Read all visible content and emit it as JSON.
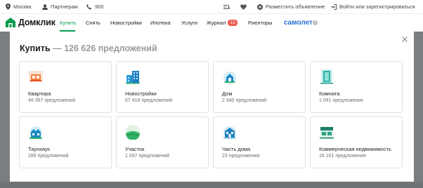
{
  "topbar": {
    "city": "Москва",
    "partners": "Партнерам",
    "phone": "900",
    "post_ad": "Разместить объявление",
    "login": "Войти или зарегистрироваться"
  },
  "nav": {
    "logo": "Домклик",
    "items": [
      {
        "label": "Купить",
        "active": true
      },
      {
        "label": "Снять"
      },
      {
        "label": "Новостройки"
      },
      {
        "label": "Ипотека"
      },
      {
        "label": "Услуги"
      },
      {
        "label": "Журнал",
        "badge": "13"
      },
      {
        "label": "Риелторы"
      }
    ],
    "partner_brand": "самолет"
  },
  "modal": {
    "title": "Купить",
    "count_text": "— 126 626 предложений",
    "cards": [
      {
        "name": "Квартира",
        "count": "48 367 предложений",
        "icon": "apartment-icon"
      },
      {
        "name": "Новостройки",
        "count": "57 418 предложений",
        "icon": "new-buildings-icon"
      },
      {
        "name": "Дом",
        "count": "2 340 предложений",
        "icon": "house-icon"
      },
      {
        "name": "Комната",
        "count": "1 041 предложение",
        "icon": "room-icon"
      },
      {
        "name": "Таунхаус",
        "count": "289 предложений",
        "icon": "townhouse-icon"
      },
      {
        "name": "Участок",
        "count": "1 047 предложений",
        "icon": "land-plot-icon"
      },
      {
        "name": "Часть дома",
        "count": "23 предложения",
        "icon": "house-part-icon"
      },
      {
        "name": "Коммерческая недвижимость",
        "count": "16 101 предложение",
        "icon": "commercial-icon"
      }
    ]
  },
  "colors": {
    "accent": "#0a9b50",
    "badge": "#ef5b4c",
    "partner_brand": "#2b6fd6",
    "count_gray": "#9a9a9a"
  }
}
